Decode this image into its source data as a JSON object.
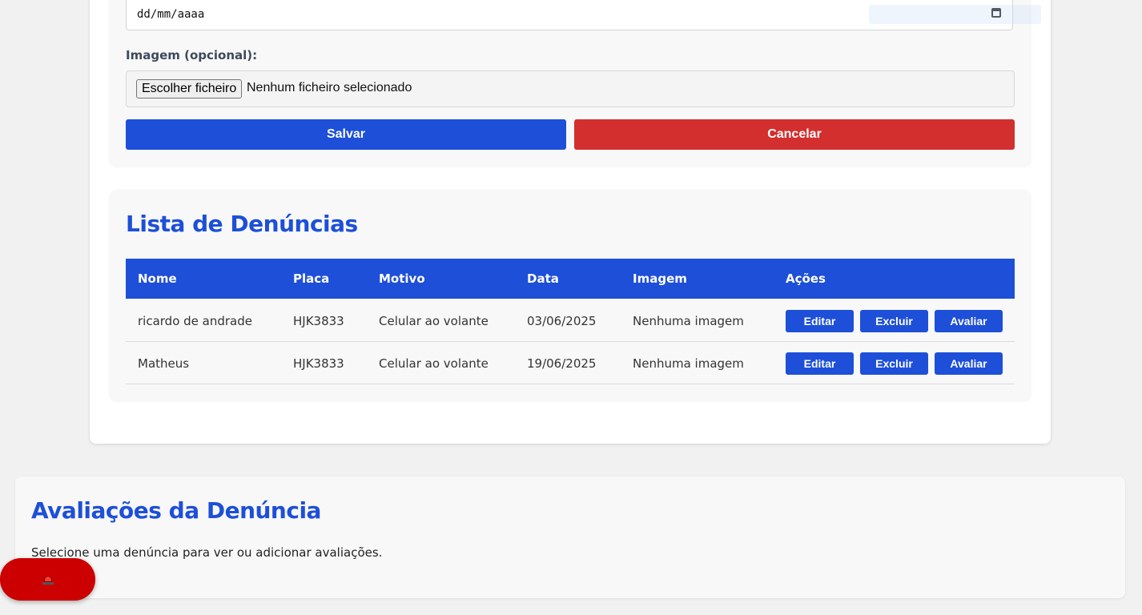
{
  "form": {
    "date_placeholder": "dd/mm/aaaa",
    "image_label": "Imagem (opcional):",
    "file_button_label": "Escolher ficheiro",
    "file_status": "Nenhum ficheiro selecionado",
    "save_label": "Salvar",
    "cancel_label": "Cancelar"
  },
  "list": {
    "title": "Lista de Denúncias",
    "columns": [
      "Nome",
      "Placa",
      "Motivo",
      "Data",
      "Imagem",
      "Ações"
    ],
    "rows": [
      {
        "nome": "ricardo de andrade",
        "placa": "HJK3833",
        "motivo": "Celular ao volante",
        "data": "03/06/2025",
        "imagem": "Nenhuma imagem"
      },
      {
        "nome": "Matheus",
        "placa": "HJK3833",
        "motivo": "Celular ao volante",
        "data": "19/06/2025",
        "imagem": "Nenhuma imagem"
      }
    ],
    "actions": {
      "edit": "Editar",
      "delete": "Excluir",
      "rate": "Avaliar"
    }
  },
  "evaluations": {
    "title": "Avaliações da Denúncia",
    "hint": "Selecione uma denúncia para ver ou adicionar avaliações."
  },
  "alert_button": {
    "icon": "siren-icon"
  },
  "colors": {
    "primary": "#1d4fd8",
    "danger": "#d32f2f",
    "alert": "#cc0000"
  }
}
